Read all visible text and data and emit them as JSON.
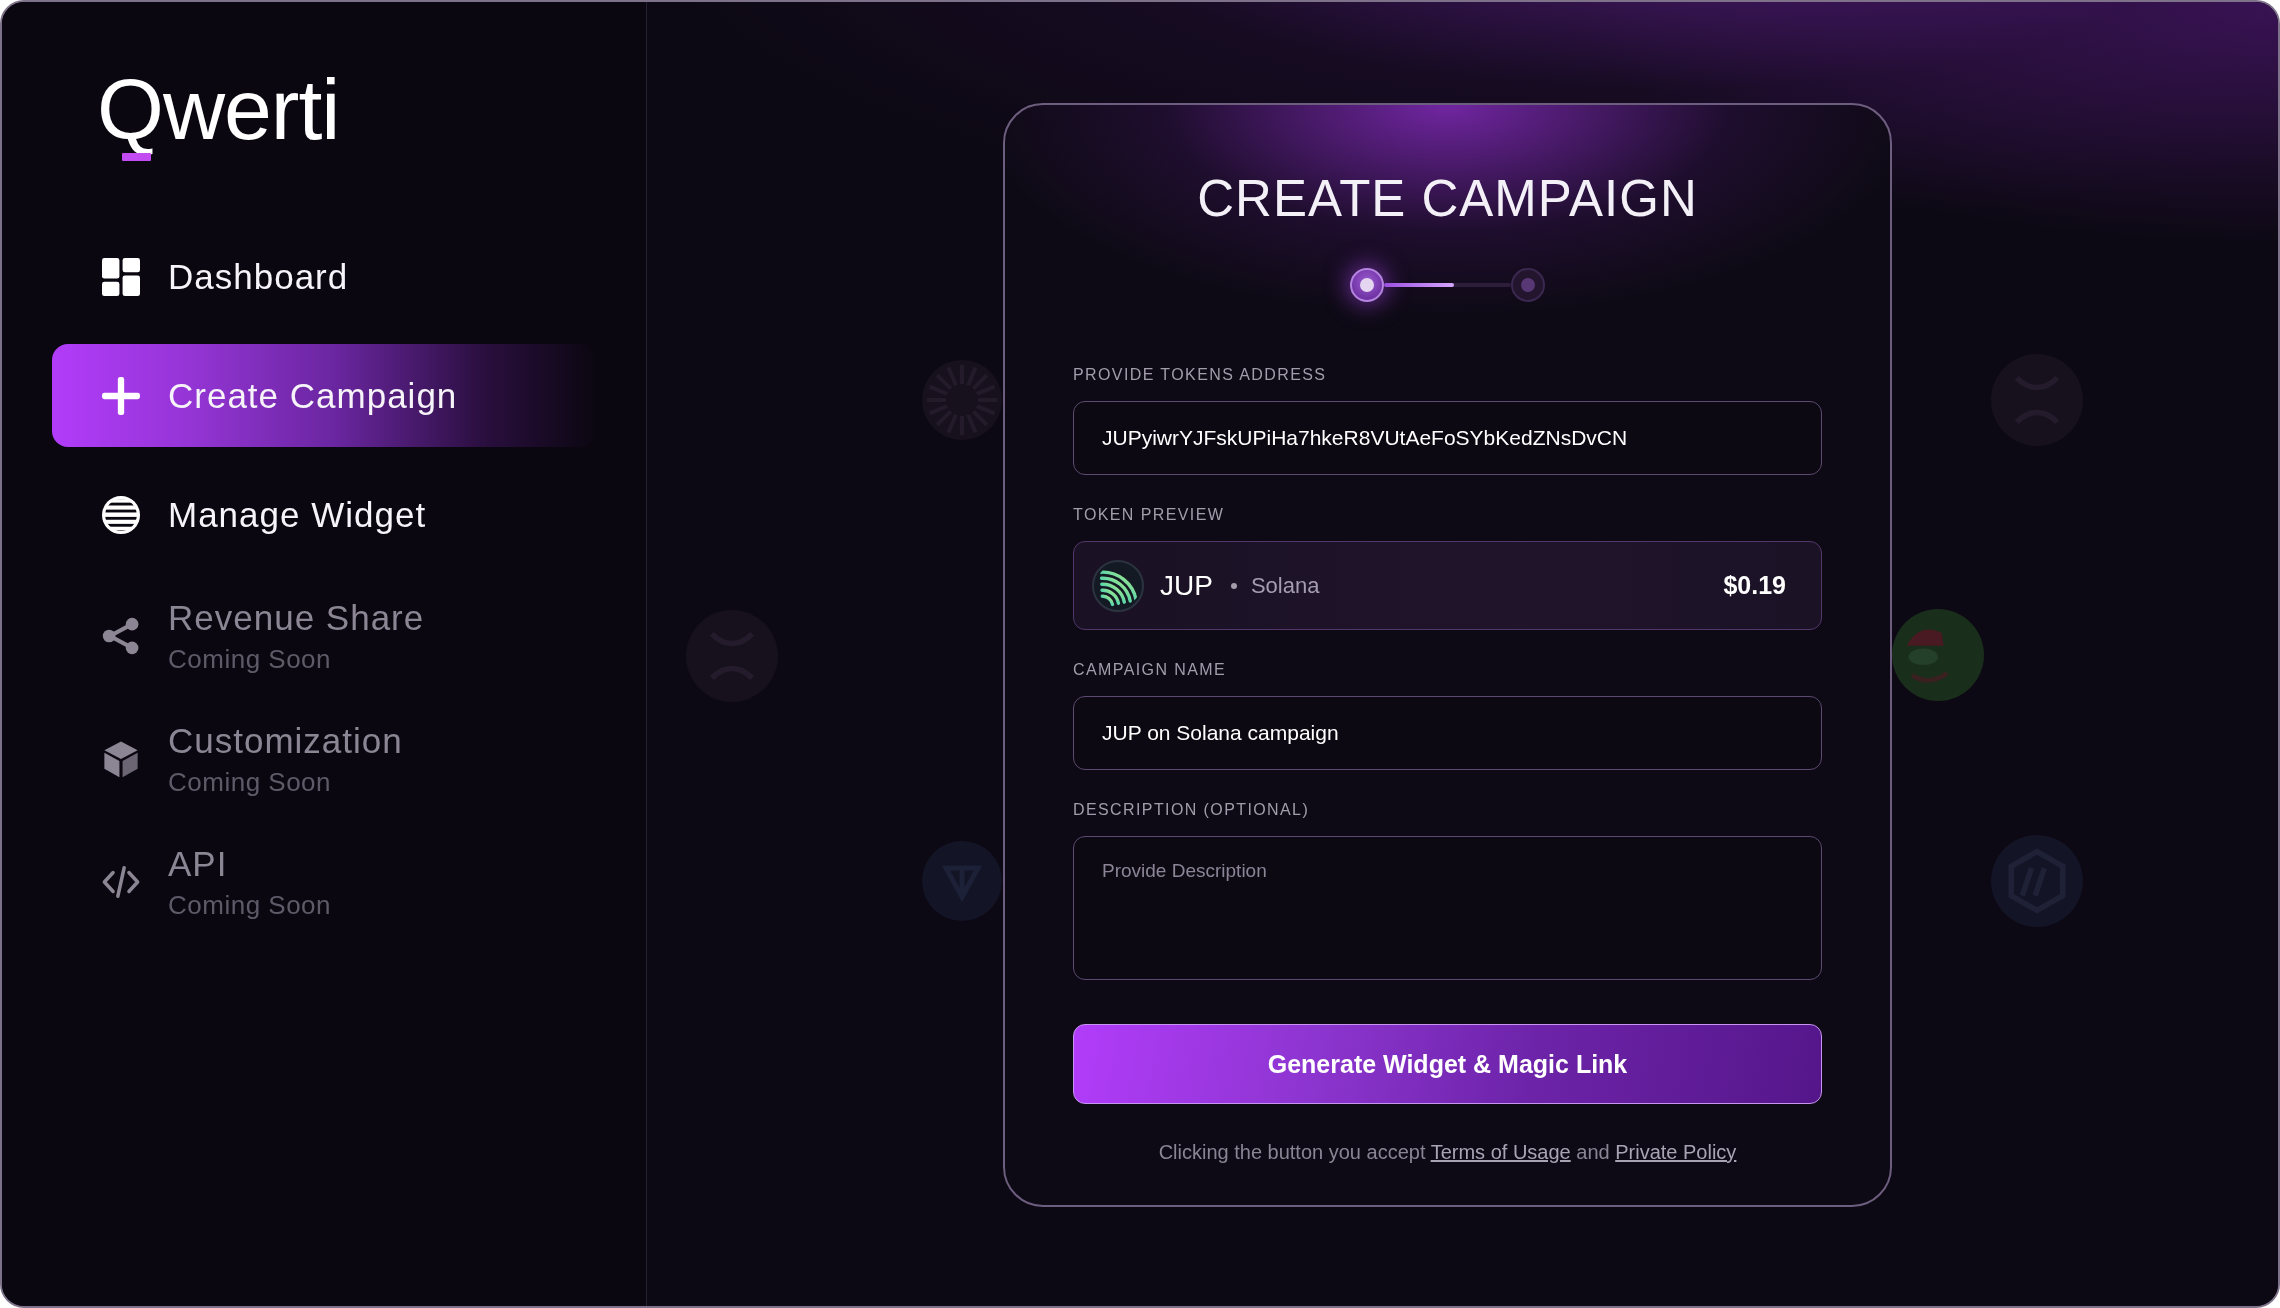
{
  "brand": {
    "name": "Qwerti"
  },
  "nav": [
    {
      "label": "Dashboard",
      "selected": false,
      "disabled": false
    },
    {
      "label": "Create Campaign",
      "selected": true,
      "disabled": false
    },
    {
      "label": "Manage Widget",
      "selected": false,
      "disabled": false
    },
    {
      "label": "Revenue Share",
      "selected": false,
      "disabled": true,
      "note": "Coming Soon"
    },
    {
      "label": "Customization",
      "selected": false,
      "disabled": true,
      "note": "Coming Soon"
    },
    {
      "label": "API",
      "selected": false,
      "disabled": true,
      "note": "Coming Soon"
    }
  ],
  "card": {
    "title": "CREATE CAMPAIGN",
    "stepper": {
      "steps": [
        {
          "selected": true
        },
        {
          "selected": false
        }
      ],
      "level": 0.55
    },
    "fields": [
      {
        "kind": "input",
        "label": "PROVIDE TOKENS ADDRESS",
        "value": "JUPyiwrYJFskUPiHa7hkeR8VUtAeFoSYbKedZNsDvCN"
      },
      {
        "kind": "token",
        "label": "TOKEN PREVIEW",
        "symbol": "JUP",
        "network": "Solana",
        "price": "$0.19"
      },
      {
        "kind": "input",
        "label": "CAMPAIGN NAME",
        "value": "JUP on Solana campaign"
      },
      {
        "kind": "textarea",
        "label": "DESCRIPTION (OPTIONAL)",
        "placeholder": "Provide Description"
      }
    ],
    "submit": {
      "label": "Generate Widget & Magic Link"
    },
    "legal": [
      {
        "kind": "text",
        "text": "Clicking the button you accept"
      },
      {
        "kind": "link",
        "text": "Terms of Usage"
      },
      {
        "kind": "text",
        "text": "and"
      },
      {
        "kind": "link",
        "text": "Private Policy"
      }
    ]
  }
}
